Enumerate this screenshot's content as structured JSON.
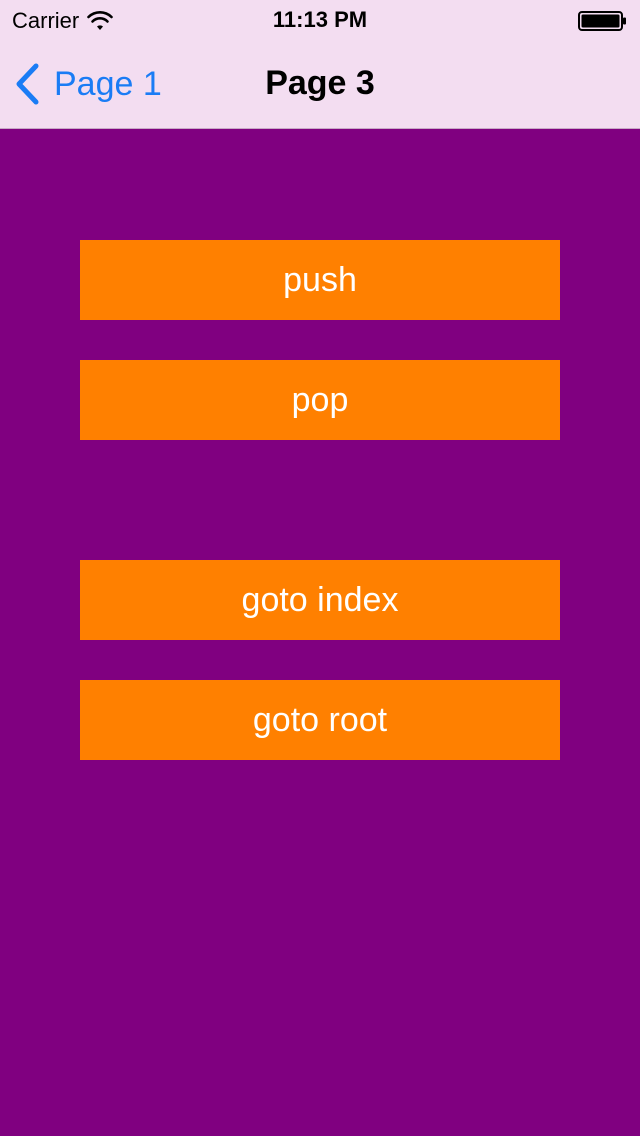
{
  "status_bar": {
    "carrier": "Carrier",
    "time": "11:13 PM",
    "icons": [
      "wifi-icon",
      "battery-icon"
    ]
  },
  "nav_bar": {
    "back_label": "Page 1",
    "title": "Page 3",
    "back_icon": "chevron-left-icon"
  },
  "buttons": {
    "push": "push",
    "pop": "pop",
    "goto_index": "goto index",
    "goto_root": "goto root"
  },
  "colors": {
    "background": "#800080",
    "nav_background": "#f3ddf1",
    "button": "#ff8000",
    "button_text": "#ffffff",
    "link": "#1a7cf5"
  }
}
